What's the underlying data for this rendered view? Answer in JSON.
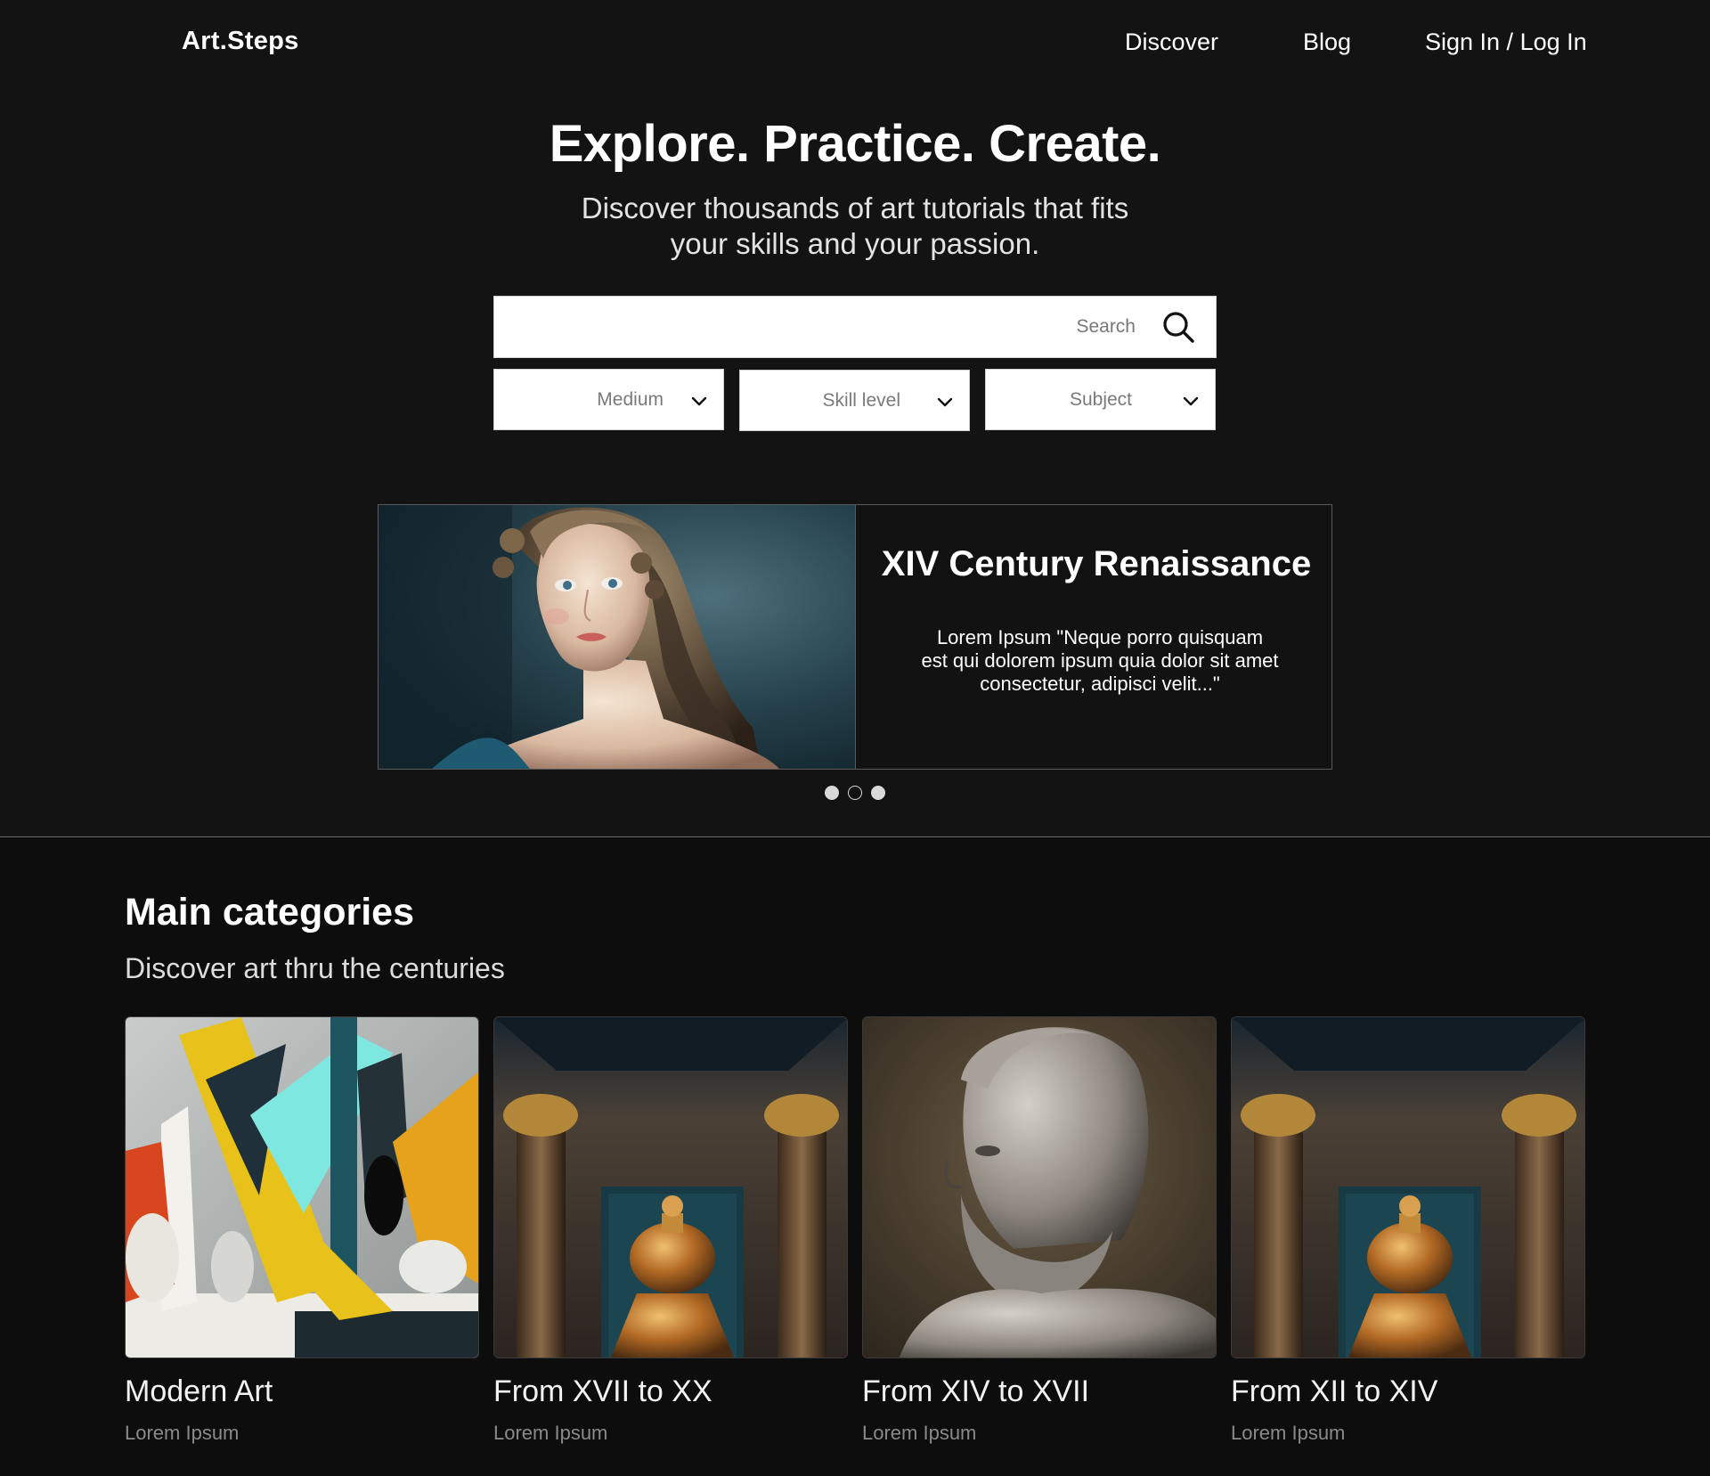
{
  "nav": {
    "logo": "Art.Steps",
    "links": [
      "Discover",
      "Blog",
      "Sign In / Log In"
    ]
  },
  "hero": {
    "title": "Explore. Practice. Create.",
    "subtitle_line1": "Discover thousands of art tutorials that fits",
    "subtitle_line2": "your skills and your passion.",
    "search_placeholder": "Search",
    "filters": [
      "Medium",
      "Skill level",
      "Subject"
    ]
  },
  "carousel": {
    "title": "XIV Century Renaissance",
    "text_line1": "Lorem Ipsum \"Neque porro quisquam",
    "text_line2": "est qui dolorem ipsum quia dolor sit amet",
    "text_line3": "consectetur, adipisci velit...\"",
    "active_dot": 2,
    "dot_count": 3
  },
  "categories": {
    "title": "Main categories",
    "subtitle": "Discover art thru the centuries",
    "cards": [
      {
        "title": "Modern Art",
        "subtitle": "Lorem Ipsum"
      },
      {
        "title": "From XVII to XX",
        "subtitle": "Lorem Ipsum"
      },
      {
        "title": "From XIV to XVII",
        "subtitle": "Lorem Ipsum"
      },
      {
        "title": "From XII to XIV",
        "subtitle": "Lorem Ipsum"
      }
    ]
  },
  "colors": {
    "background": "#131313",
    "section_background": "#0d0d0d",
    "text": "#ffffff",
    "muted": "#8a8a8a"
  }
}
